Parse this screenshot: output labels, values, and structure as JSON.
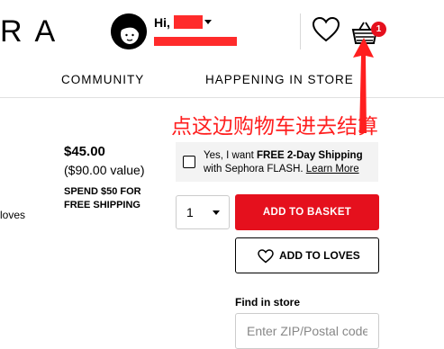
{
  "header": {
    "logo_text": "RA",
    "greeting": "Hi, J",
    "cart_count": "1"
  },
  "nav": {
    "items": [
      "COMMUNITY",
      "HAPPENING IN STORE"
    ]
  },
  "annotation": {
    "text": "点这边购物车进去结算",
    "color": "#ff1f1f"
  },
  "product": {
    "price": "$45.00",
    "value": "($90.00 value)",
    "promo_line1": "SPEND $50 FOR",
    "promo_line2": "FREE SHIPPING",
    "loves_fragment": "loves"
  },
  "shipping": {
    "line1_prefix": "Yes, I want ",
    "line1_bold": "FREE 2-Day Shipping",
    "line2_prefix": "with Sephora FLASH. ",
    "learn_more": "Learn More"
  },
  "purchase": {
    "quantity": "1",
    "add_to_basket": "ADD TO BASKET",
    "add_to_loves": "ADD TO LOVES"
  },
  "find_in_store": {
    "label": "Find in store",
    "placeholder": "Enter ZIP/Postal code"
  },
  "colors": {
    "brand_red": "#e5101d",
    "redaction": "#ff2b2b"
  }
}
